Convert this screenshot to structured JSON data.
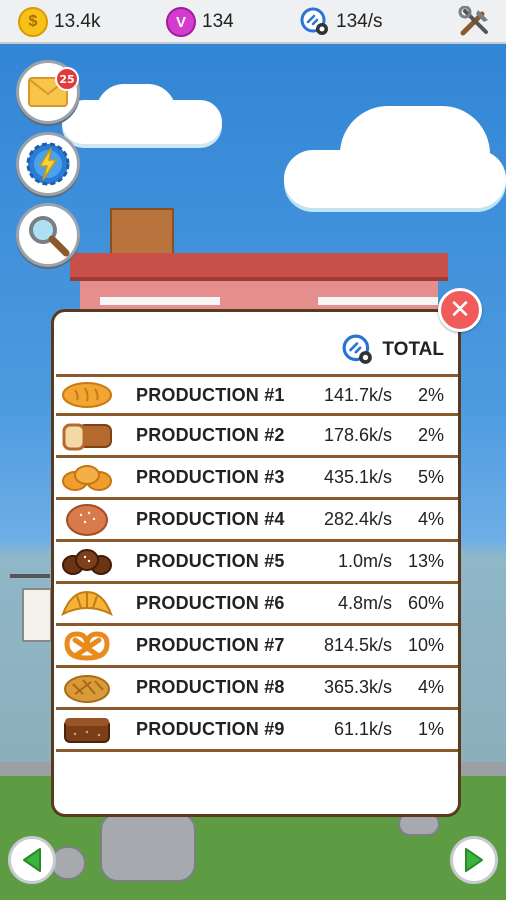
{
  "topbar": {
    "coins": "13.4k",
    "coin_icon_letter": "$",
    "gems": "134",
    "gem_icon_letter": "V",
    "rate": "134/s"
  },
  "side_buttons": {
    "mail_badge": "25"
  },
  "panel": {
    "total_label": "TOTAL",
    "close_glyph": "✕",
    "rows": [
      {
        "name": "PRODUCTION #1",
        "rate": "141.7k/s",
        "pct": "2%",
        "icon": "bread-loaf-icon"
      },
      {
        "name": "PRODUCTION #2",
        "rate": "178.6k/s",
        "pct": "2%",
        "icon": "toast-loaf-icon"
      },
      {
        "name": "PRODUCTION #3",
        "rate": "435.1k/s",
        "pct": "5%",
        "icon": "buns-icon"
      },
      {
        "name": "PRODUCTION #4",
        "rate": "282.4k/s",
        "pct": "4%",
        "icon": "round-bread-icon"
      },
      {
        "name": "PRODUCTION #5",
        "rate": "1.0m/s",
        "pct": "13%",
        "icon": "dark-buns-icon"
      },
      {
        "name": "PRODUCTION #6",
        "rate": "4.8m/s",
        "pct": "60%",
        "icon": "croissant-icon"
      },
      {
        "name": "PRODUCTION #7",
        "rate": "814.5k/s",
        "pct": "10%",
        "icon": "pretzel-icon"
      },
      {
        "name": "PRODUCTION #8",
        "rate": "365.3k/s",
        "pct": "4%",
        "icon": "cob-loaf-icon"
      },
      {
        "name": "PRODUCTION #9",
        "rate": "61.1k/s",
        "pct": "1%",
        "icon": "rye-loaf-icon"
      }
    ]
  },
  "colors": {
    "panel_border": "#5a3a1f",
    "row_divider": "#8a5a2b",
    "close_button": "#f05c5c",
    "nav_arrow": "#3bb43b"
  }
}
